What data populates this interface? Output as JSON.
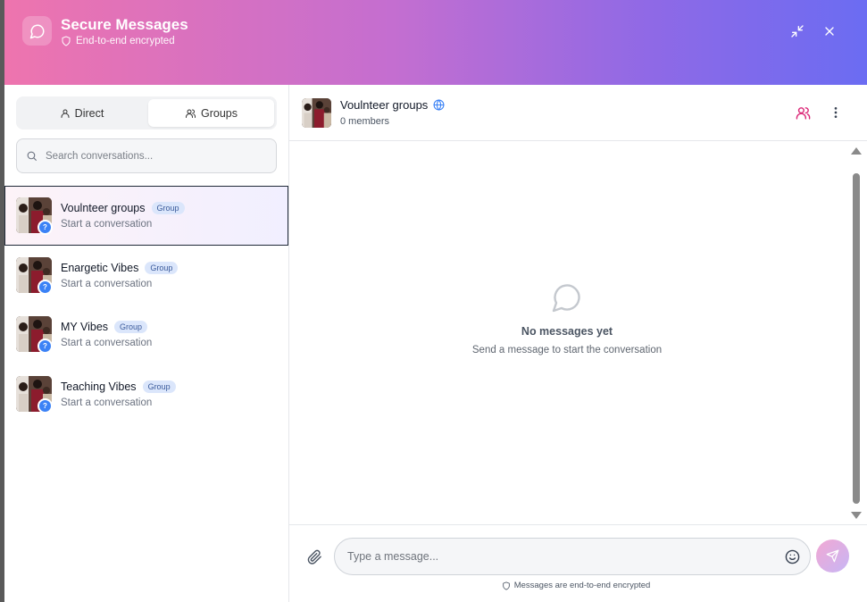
{
  "header": {
    "title": "Secure Messages",
    "subtitle": "End-to-end encrypted",
    "minimize_icon": "minimize-icon",
    "close_icon": "close-icon"
  },
  "tabs": [
    {
      "label": "Direct",
      "icon": "user-icon",
      "active": false
    },
    {
      "label": "Groups",
      "icon": "users-icon",
      "active": true
    }
  ],
  "search": {
    "placeholder": "Search conversations..."
  },
  "conversations": [
    {
      "name": "Voulnteer groups",
      "badge": "Group",
      "subtitle": "Start a conversation",
      "status": "?",
      "active": true
    },
    {
      "name": "Enargetic Vibes",
      "badge": "Group",
      "subtitle": "Start a conversation",
      "status": "?",
      "active": false
    },
    {
      "name": "MY Vibes",
      "badge": "Group",
      "subtitle": "Start a conversation",
      "status": "?",
      "active": false
    },
    {
      "name": "Teaching Vibes",
      "badge": "Group",
      "subtitle": "Start a conversation",
      "status": "?",
      "active": false
    }
  ],
  "chat": {
    "title": "Voulnteer groups",
    "members": "0 members",
    "empty_title": "No messages yet",
    "empty_subtitle": "Send a message to start the conversation"
  },
  "composer": {
    "placeholder": "Type a message...",
    "encryption_note": "Messages are end-to-end encrypted"
  },
  "colors": {
    "header_gradient_start": "#ee74ae",
    "header_gradient_end": "#6b6cf2",
    "badge_blue": "#3b82f6",
    "members_icon": "#db2777",
    "globe_icon": "#3b82f6"
  }
}
